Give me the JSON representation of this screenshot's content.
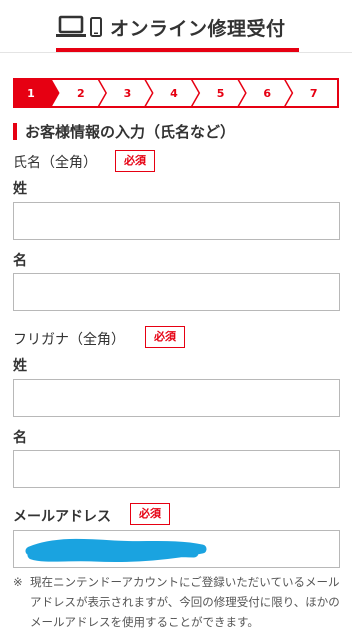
{
  "header": {
    "title": "オンライン修理受付"
  },
  "steps": {
    "labels": [
      "1",
      "2",
      "3",
      "4",
      "5",
      "6",
      "7"
    ],
    "active_index": 0
  },
  "section": {
    "title": "お客様情報の入力（氏名など）"
  },
  "name_group": {
    "label": "氏名（全角）",
    "required": "必須",
    "last_label": "姓",
    "first_label": "名",
    "last_value": "",
    "first_value": ""
  },
  "kana_group": {
    "label": "フリガナ（全角）",
    "required": "必須",
    "last_label": "姓",
    "first_label": "名",
    "last_value": "",
    "first_value": ""
  },
  "email_group": {
    "label": "メールアドレス",
    "required": "必須"
  },
  "note": {
    "mark": "※",
    "text": "現在ニンテンドーアカウントにご登録いただいているメールアドレスが表示されますが、今回の修理受付に限り、ほかのメールアドレスを使用することができます。"
  },
  "colors": {
    "accent": "#e60012",
    "text": "#333333",
    "field_border": "#b8b8b8",
    "scribble": "#1aa3e0"
  }
}
